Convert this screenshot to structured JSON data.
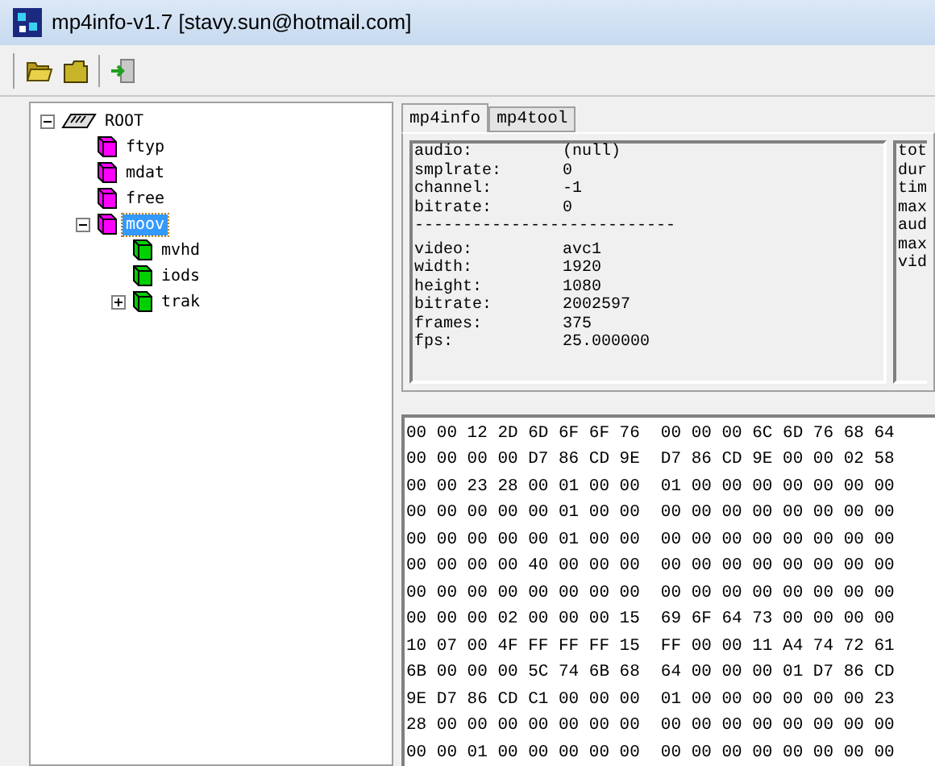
{
  "window": {
    "title": "mp4info-v1.7 [stavy.sun@hotmail.com]"
  },
  "tree": [
    {
      "label": "ROOT",
      "kind": "root",
      "expanded": true,
      "selected": false,
      "children": [
        {
          "label": "ftyp",
          "kind": "atom",
          "selected": false
        },
        {
          "label": "mdat",
          "kind": "atom",
          "selected": false
        },
        {
          "label": "free",
          "kind": "atom",
          "selected": false
        },
        {
          "label": "moov",
          "kind": "atom",
          "selected": true,
          "expanded": true,
          "children": [
            {
              "label": "mvhd",
              "kind": "child",
              "selected": false
            },
            {
              "label": "iods",
              "kind": "child",
              "selected": false
            },
            {
              "label": "trak",
              "kind": "child",
              "selected": false,
              "expanded": false
            }
          ]
        }
      ]
    }
  ],
  "tabs": [
    {
      "label": "mp4info",
      "selected": true
    },
    {
      "label": "mp4tool",
      "selected": false
    }
  ],
  "info": {
    "lines": [
      {
        "kind": "pair",
        "label": "audio:",
        "value": "(null)"
      },
      {
        "kind": "pair",
        "label": "smplrate:",
        "value": "0"
      },
      {
        "kind": "pair",
        "label": "channel:",
        "value": "-1"
      },
      {
        "kind": "pair",
        "label": "bitrate:",
        "value": "0"
      },
      {
        "kind": "rule",
        "text": "---------------------------"
      },
      {
        "kind": "pair",
        "label": "video:",
        "value": "avc1"
      },
      {
        "kind": "pair",
        "label": "width:",
        "value": "1920"
      },
      {
        "kind": "pair",
        "label": "height:",
        "value": "1080"
      },
      {
        "kind": "pair",
        "label": "bitrate:",
        "value": "2002597"
      },
      {
        "kind": "pair",
        "label": "frames:",
        "value": "375"
      },
      {
        "kind": "pair",
        "label": "fps:",
        "value": "25.000000"
      }
    ],
    "side_lines": [
      "tot",
      "dur",
      "tim",
      "max",
      "aud",
      "max",
      "vid"
    ]
  },
  "hex_rows": [
    [
      "00 00 12 2D 6D 6F 6F 76",
      "00 00 00 6C 6D 76 68 64"
    ],
    [
      "00 00 00 00 D7 86 CD 9E",
      "D7 86 CD 9E 00 00 02 58"
    ],
    [
      "00 00 23 28 00 01 00 00",
      "01 00 00 00 00 00 00 00"
    ],
    [
      "00 00 00 00 00 01 00 00",
      "00 00 00 00 00 00 00 00"
    ],
    [
      "00 00 00 00 00 01 00 00",
      "00 00 00 00 00 00 00 00"
    ],
    [
      "00 00 00 00 40 00 00 00",
      "00 00 00 00 00 00 00 00"
    ],
    [
      "00 00 00 00 00 00 00 00",
      "00 00 00 00 00 00 00 00"
    ],
    [
      "00 00 00 02 00 00 00 15",
      "69 6F 64 73 00 00 00 00"
    ],
    [
      "10 07 00 4F FF FF FF 15",
      "FF 00 00 11 A4 74 72 61"
    ],
    [
      "6B 00 00 00 5C 74 6B 68",
      "64 00 00 00 01 D7 86 CD"
    ],
    [
      "9E D7 86 CD C1 00 00 00",
      "01 00 00 00 00 00 00 23"
    ],
    [
      "28 00 00 00 00 00 00 00",
      "00 00 00 00 00 00 00 00"
    ],
    [
      "00 00 01 00 00 00 00 00",
      "00 00 00 00 00 00 00 00"
    ]
  ]
}
